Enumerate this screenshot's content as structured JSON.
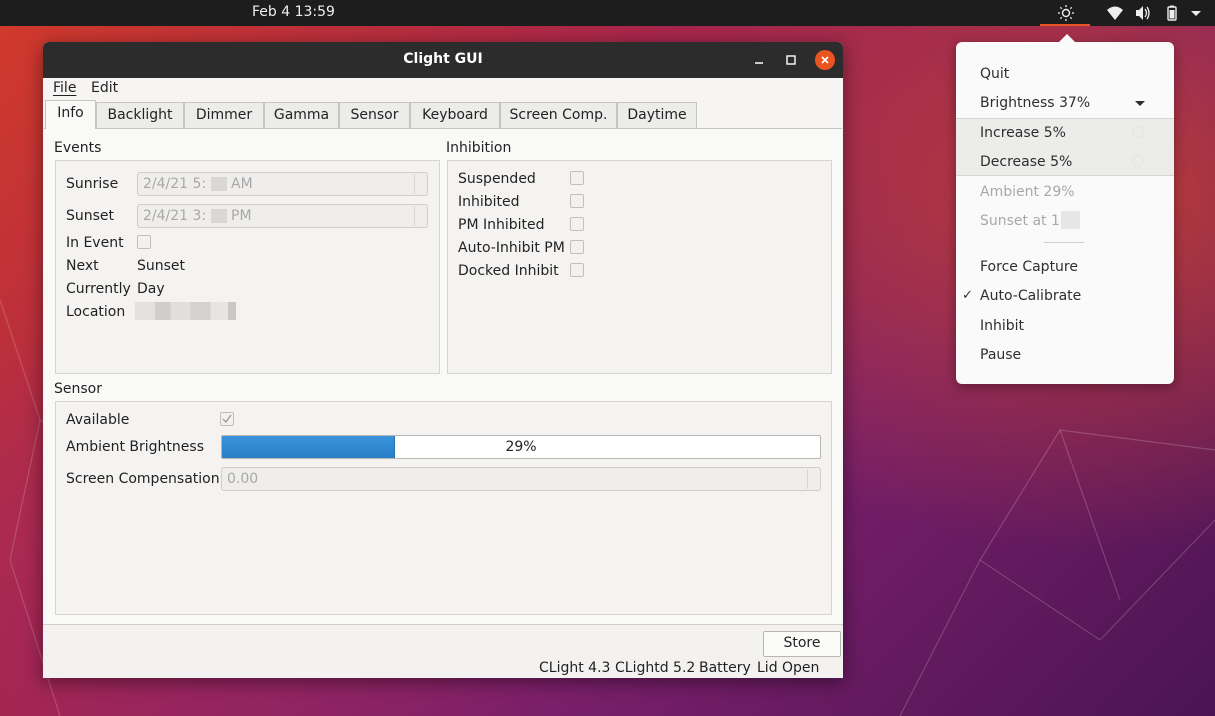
{
  "topbar": {
    "clock": "Feb 4  13:59",
    "icons": [
      "brightness-icon",
      "wifi-icon",
      "volume-icon",
      "battery-icon",
      "system-menu-chevron-icon"
    ]
  },
  "window": {
    "title": "Clight GUI",
    "menu": {
      "file": "File",
      "edit": "Edit"
    },
    "tabs": [
      "Info",
      "Backlight",
      "Dimmer",
      "Gamma",
      "Sensor",
      "Keyboard",
      "Screen Comp.",
      "Daytime"
    ],
    "active_tab": "Info",
    "events": {
      "label": "Events",
      "sunrise_label": "Sunrise",
      "sunrise_value": "2/4/21 5:",
      "sunrise_suffix": "AM",
      "sunset_label": "Sunset",
      "sunset_value": "2/4/21 3:",
      "sunset_suffix": "PM",
      "in_event_label": "In Event",
      "next_label": "Next",
      "next_value": "Sunset",
      "currently_label": "Currently",
      "currently_value": "Day",
      "location_label": "Location"
    },
    "inhibition": {
      "label": "Inhibition",
      "items": [
        "Suspended",
        "Inhibited",
        "PM Inhibited",
        "Auto-Inhibit PM",
        "Docked Inhibit"
      ]
    },
    "sensor": {
      "label": "Sensor",
      "available_label": "Available",
      "available_checked": true,
      "ambient_label": "Ambient Brightness",
      "ambient_fraction": 0.29,
      "ambient_text": "29%",
      "screen_comp_label": "Screen Compensation",
      "screen_comp_value": "0.00"
    },
    "store_label": "Store",
    "status": {
      "clight": "CLight 4.3",
      "clightd": "CLightd 5.2",
      "battery": "Battery",
      "lid": "Lid Open"
    }
  },
  "tray_menu": {
    "quit": "Quit",
    "brightness": "Brightness 37%",
    "increase": "Increase 5%",
    "decrease": "Decrease 5%",
    "ambient": "Ambient 29%",
    "sunset": "Sunset at 15",
    "force_capture": "Force Capture",
    "auto_calibrate": "Auto-Calibrate",
    "auto_calibrate_checked": true,
    "inhibit": "Inhibit",
    "pause": "Pause"
  }
}
